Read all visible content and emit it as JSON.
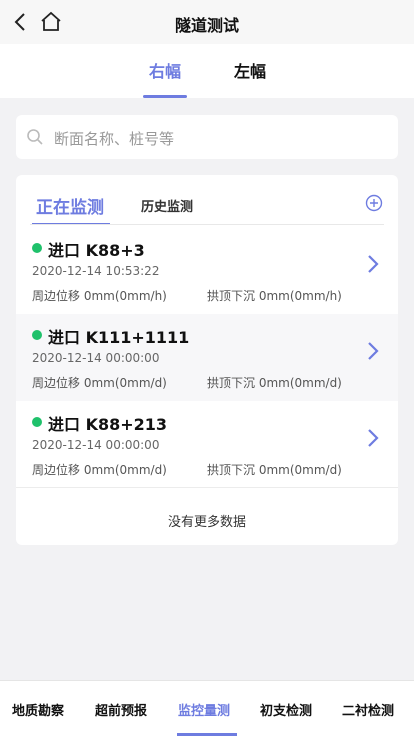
{
  "nav": {
    "title": "隧道测试"
  },
  "side_tabs": [
    {
      "label": "右幅",
      "active": true
    },
    {
      "label": "左幅",
      "active": false
    }
  ],
  "search": {
    "placeholder": "断面名称、桩号等"
  },
  "monitor_tabs": [
    {
      "label": "正在监测",
      "active": true
    },
    {
      "label": "历史监测",
      "active": false
    }
  ],
  "items": [
    {
      "name": "进口 K88+3",
      "time": "2020-12-14 10:53:22",
      "displacement": "周边位移  0mm(0mm/h)",
      "settlement": "拱顶下沉  0mm(0mm/h)",
      "status": "green"
    },
    {
      "name": "进口 K111+1111",
      "time": "2020-12-14 00:00:00",
      "displacement": "周边位移  0mm(0mm/d)",
      "settlement": "拱顶下沉  0mm(0mm/d)",
      "status": "green"
    },
    {
      "name": "进口 K88+213",
      "time": "2020-12-14 00:00:00",
      "displacement": "周边位移  0mm(0mm/d)",
      "settlement": "拱顶下沉  0mm(0mm/d)",
      "status": "green"
    }
  ],
  "no_more": "没有更多数据",
  "bottom_nav": [
    {
      "label": "地质勘察",
      "active": false
    },
    {
      "label": "超前预报",
      "active": false
    },
    {
      "label": "监控量测",
      "active": true
    },
    {
      "label": "初支检测",
      "active": false
    },
    {
      "label": "二衬检测",
      "active": false
    }
  ],
  "colors": {
    "accent": "#6e7ce0",
    "status_green": "#1fc16b"
  },
  "icons": {
    "back": "chevron-left-icon",
    "home": "home-icon",
    "search": "search-icon",
    "add": "plus-circle-icon",
    "item_arrow": "chevron-right-icon"
  }
}
